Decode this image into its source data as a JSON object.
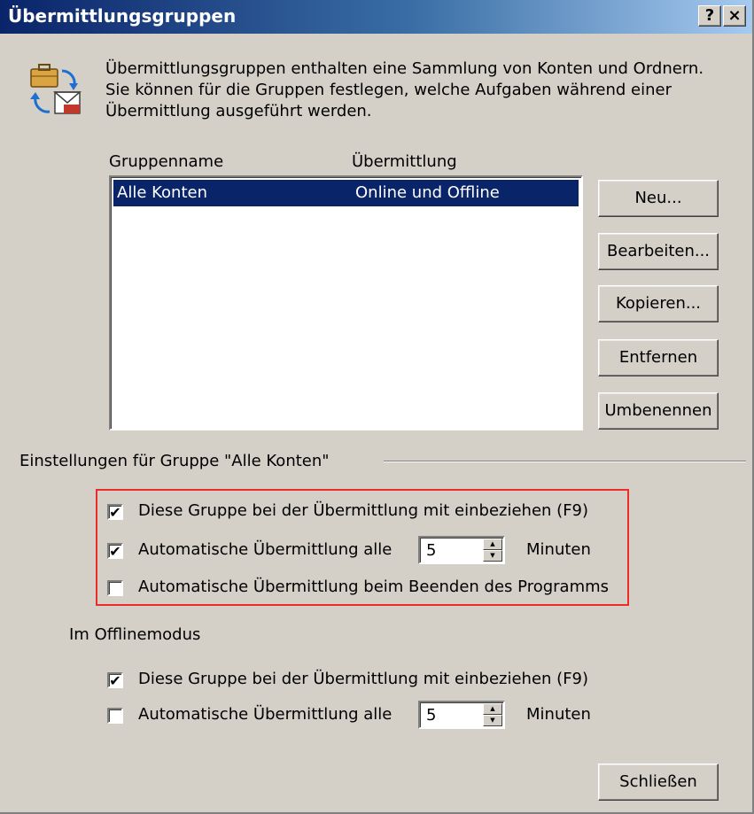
{
  "window": {
    "title": "Übermittlungsgruppen",
    "help_label": "?",
    "close_label": "×"
  },
  "description": {
    "line1": "Übermittlungsgruppen enthalten eine Sammlung von Konten und Ordnern.",
    "line2": "Sie können für die Gruppen festlegen, welche Aufgaben während einer",
    "line3": "Übermittlung ausgeführt werden."
  },
  "groups": {
    "col_name": "Gruppenname",
    "col_transfer": "Übermittlung",
    "rows": [
      {
        "name": "Alle Konten",
        "transfer": "Online und Offline",
        "selected": true
      }
    ]
  },
  "buttons": {
    "new": "Neu...",
    "edit": "Bearbeiten...",
    "copy": "Kopieren...",
    "remove": "Entfernen",
    "rename": "Umbenennen",
    "close": "Schließen"
  },
  "settings": {
    "heading": "Einstellungen für Gruppe \"Alle Konten\"",
    "online": {
      "include_label": "Diese Gruppe bei der Übermittlung mit einbeziehen (F9)",
      "include_checked": "✔",
      "auto_label": "Automatische Übermittlung alle",
      "auto_checked": "✔",
      "auto_minutes": "5",
      "minutes_label": "Minuten",
      "exit_label": "Automatische Übermittlung beim Beenden des Programms",
      "exit_checked": ""
    },
    "offline": {
      "heading": "Im Offlinemodus",
      "include_label": "Diese Gruppe bei der Übermittlung mit einbeziehen (F9)",
      "include_checked": "✔",
      "auto_label": "Automatische Übermittlung alle",
      "auto_checked": "",
      "auto_minutes": "5",
      "minutes_label": "Minuten"
    }
  },
  "colors": {
    "dialog_bg": "#d4d0c8",
    "title_start": "#0a246a",
    "title_end": "#a6caf0",
    "selection": "#0a246a",
    "highlight_box": "#ee2a2a"
  },
  "icons": [
    "briefcase-sync-icon",
    "spin-up-icon",
    "spin-down-icon"
  ]
}
